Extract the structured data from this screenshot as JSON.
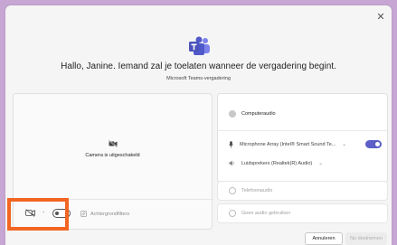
{
  "dialog": {
    "close_glyph": "✕",
    "headline": "Hallo, Janine. Iemand zal je toelaten wanneer de vergadering begint.",
    "subtitle": "Microsoft Teams-vergadering"
  },
  "video": {
    "camera_off_text": "Camera is uitgeschakeld",
    "camera_toggle_on": false,
    "background_filters_label": "Achtergrondfilters",
    "dropdown_chevron": "⌄"
  },
  "audio": {
    "computer_audio_label": "Computeraudio",
    "computer_audio_selected": true,
    "microphone_label": "Microphone Array (Intel® Smart Sound Te...",
    "microphone_on": true,
    "speaker_label": "Luidsprekers (Realtek(R) Audio)",
    "phone_audio_label": "Telefoonaudio",
    "no_audio_label": "Geen audio gebruiken",
    "dropdown_chevron": "⌄"
  },
  "actions": {
    "cancel_label": "Annuleren",
    "join_label": "Nu deelnemen"
  },
  "colors": {
    "accent": "#5b5fc7",
    "highlight": "#f26522",
    "background": "#c7a6d4"
  }
}
